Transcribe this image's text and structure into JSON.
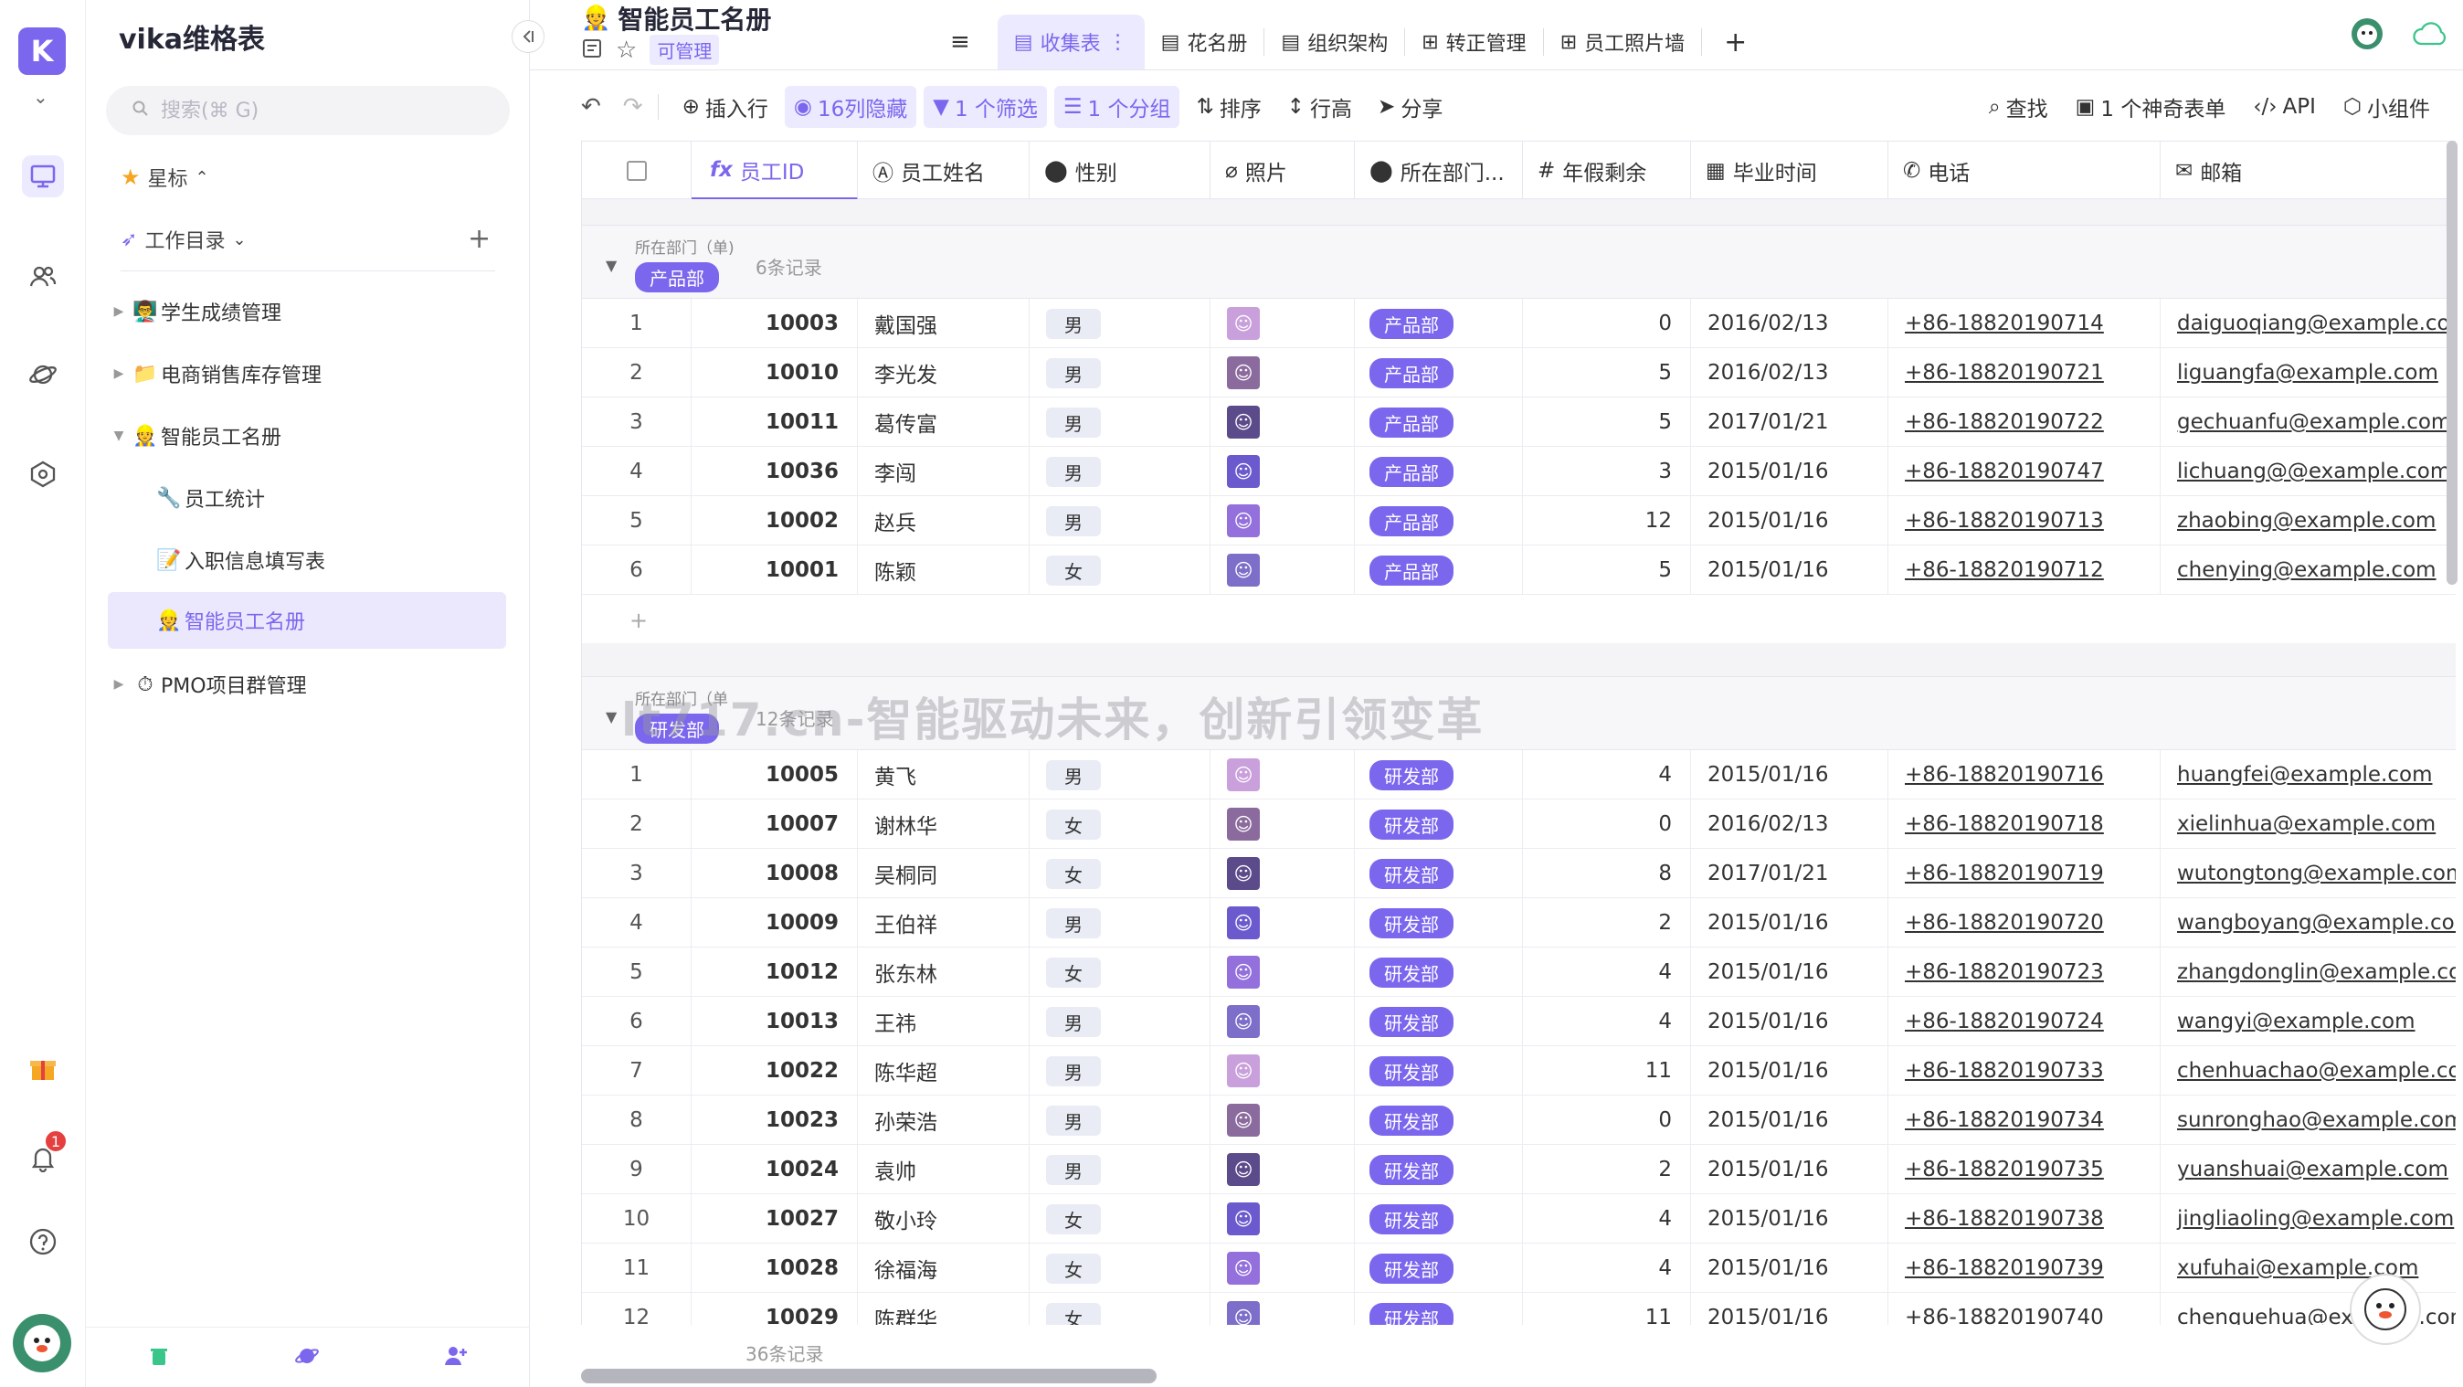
{
  "app": {
    "name": "vika维格表"
  },
  "search": {
    "placeholder": "搜索(⌘ G)"
  },
  "sidebar": {
    "starred_label": "星标",
    "workdir_label": "工作目录",
    "items": [
      {
        "label": "学生成绩管理",
        "icon": "👨‍🏫"
      },
      {
        "label": "电商销售库存管理",
        "icon": "📁"
      },
      {
        "label": "智能员工名册",
        "icon": "👷"
      },
      {
        "label": "员工统计",
        "icon": "🔧"
      },
      {
        "label": "入职信息填写表",
        "icon": "📝"
      },
      {
        "label": "智能员工名册",
        "icon": "👷"
      },
      {
        "label": "PMO项目群管理",
        "icon": "⏱"
      }
    ]
  },
  "header": {
    "title": "智能员工名册",
    "manage_tag": "可管理",
    "views": [
      {
        "label": "收集表"
      },
      {
        "label": "花名册"
      },
      {
        "label": "组织架构"
      },
      {
        "label": "转正管理"
      },
      {
        "label": "员工照片墙"
      }
    ]
  },
  "toolbar": {
    "insert_row": "插入行",
    "hidden_cols": "16列隐藏",
    "filter": "1 个筛选",
    "group": "1 个分组",
    "sort": "排序",
    "row_height": "行高",
    "share": "分享",
    "find": "查找",
    "magic_form": "1 个神奇表单",
    "api": "API",
    "widget": "小组件"
  },
  "columns": {
    "id": "员工ID",
    "name": "员工姓名",
    "gender": "性别",
    "photo": "照片",
    "dept": "所在部门...",
    "leave": "年假剩余",
    "grad": "毕业时间",
    "phone": "电话",
    "email": "邮箱"
  },
  "groups": [
    {
      "field_label": "所在部门（单)",
      "dept": "产品部",
      "count_label": "6条记录",
      "rows": [
        {
          "idx": "1",
          "id": "10003",
          "name": "戴国强",
          "gender": "男",
          "dept": "产品部",
          "leave": "0",
          "grad": "2016/02/13",
          "phone": "+86-18820190714",
          "email": "daiguoqiang@example.com"
        },
        {
          "idx": "2",
          "id": "10010",
          "name": "李光发",
          "gender": "男",
          "dept": "产品部",
          "leave": "5",
          "grad": "2016/02/13",
          "phone": "+86-18820190721",
          "email": "liguangfa@example.com"
        },
        {
          "idx": "3",
          "id": "10011",
          "name": "葛传富",
          "gender": "男",
          "dept": "产品部",
          "leave": "5",
          "grad": "2017/01/21",
          "phone": "+86-18820190722",
          "email": "gechuanfu@example.com"
        },
        {
          "idx": "4",
          "id": "10036",
          "name": "李闯",
          "gender": "男",
          "dept": "产品部",
          "leave": "3",
          "grad": "2015/01/16",
          "phone": "+86-18820190747",
          "email": "lichuang@@example.com"
        },
        {
          "idx": "5",
          "id": "10002",
          "name": "赵兵",
          "gender": "男",
          "dept": "产品部",
          "leave": "12",
          "grad": "2015/01/16",
          "phone": "+86-18820190713",
          "email": "zhaobing@example.com"
        },
        {
          "idx": "6",
          "id": "10001",
          "name": "陈颖",
          "gender": "女",
          "dept": "产品部",
          "leave": "5",
          "grad": "2015/01/16",
          "phone": "+86-18820190712",
          "email": "chenying@example.com"
        }
      ]
    },
    {
      "field_label": "所在部门（单",
      "dept": "研发部",
      "count_label": "12条记录",
      "rows": [
        {
          "idx": "1",
          "id": "10005",
          "name": "黄飞",
          "gender": "男",
          "dept": "研发部",
          "leave": "4",
          "grad": "2015/01/16",
          "phone": "+86-18820190716",
          "email": "huangfei@example.com"
        },
        {
          "idx": "2",
          "id": "10007",
          "name": "谢林华",
          "gender": "女",
          "dept": "研发部",
          "leave": "0",
          "grad": "2016/02/13",
          "phone": "+86-18820190718",
          "email": "xielinhua@example.com"
        },
        {
          "idx": "3",
          "id": "10008",
          "name": "吴桐同",
          "gender": "女",
          "dept": "研发部",
          "leave": "8",
          "grad": "2017/01/21",
          "phone": "+86-18820190719",
          "email": "wutongtong@example.com"
        },
        {
          "idx": "4",
          "id": "10009",
          "name": "王伯祥",
          "gender": "男",
          "dept": "研发部",
          "leave": "2",
          "grad": "2015/01/16",
          "phone": "+86-18820190720",
          "email": "wangboyang@example.com"
        },
        {
          "idx": "5",
          "id": "10012",
          "name": "张东林",
          "gender": "女",
          "dept": "研发部",
          "leave": "4",
          "grad": "2015/01/16",
          "phone": "+86-18820190723",
          "email": "zhangdonglin@example.com"
        },
        {
          "idx": "6",
          "id": "10013",
          "name": "王祎",
          "gender": "男",
          "dept": "研发部",
          "leave": "4",
          "grad": "2015/01/16",
          "phone": "+86-18820190724",
          "email": "wangyi@example.com"
        },
        {
          "idx": "7",
          "id": "10022",
          "name": "陈华超",
          "gender": "男",
          "dept": "研发部",
          "leave": "11",
          "grad": "2015/01/16",
          "phone": "+86-18820190733",
          "email": "chenhuachao@example.com"
        },
        {
          "idx": "8",
          "id": "10023",
          "name": "孙荣浩",
          "gender": "男",
          "dept": "研发部",
          "leave": "0",
          "grad": "2015/01/16",
          "phone": "+86-18820190734",
          "email": "sunronghao@example.com"
        },
        {
          "idx": "9",
          "id": "10024",
          "name": "袁帅",
          "gender": "男",
          "dept": "研发部",
          "leave": "2",
          "grad": "2015/01/16",
          "phone": "+86-18820190735",
          "email": "yuanshuai@example.com"
        },
        {
          "idx": "10",
          "id": "10027",
          "name": "敬小玲",
          "gender": "女",
          "dept": "研发部",
          "leave": "4",
          "grad": "2015/01/16",
          "phone": "+86-18820190738",
          "email": "jingliaoling@example.com"
        },
        {
          "idx": "11",
          "id": "10028",
          "name": "徐福海",
          "gender": "女",
          "dept": "研发部",
          "leave": "4",
          "grad": "2015/01/16",
          "phone": "+86-18820190739",
          "email": "xufuhai@example.com"
        },
        {
          "idx": "12",
          "id": "10029",
          "name": "陈群华",
          "gender": "女",
          "dept": "研发部",
          "leave": "11",
          "grad": "2015/01/16",
          "phone": "+86-18820190740",
          "email": "chenquehua@example.com"
        }
      ]
    }
  ],
  "footer": {
    "total": "36条记录"
  },
  "watermark": "lt717.cn-智能驱动未来，创新引领变革",
  "notifications": {
    "count": "1"
  },
  "colors": {
    "accent": "#7b67ee",
    "badge": "#e5403f"
  }
}
